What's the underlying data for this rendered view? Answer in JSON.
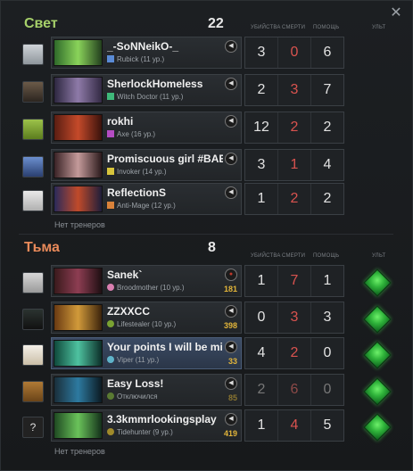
{
  "radiant": {
    "title": "Свет",
    "score": "22",
    "columns": {
      "kills": "Убийства",
      "deaths": "Смерти",
      "assists": "Помощь",
      "ult": "Ульт"
    },
    "players": [
      {
        "name": "_-SoNNeikO-_",
        "hero": "Rubick",
        "level_text": "(11 ур.)",
        "hero_color": "#5a8bd6",
        "kills": "3",
        "deaths": "0",
        "assists": "6"
      },
      {
        "name": "SherlockHomeless",
        "hero": "Witch Doctor",
        "level_text": "(11 ур.)",
        "hero_color": "#3fb97a",
        "kills": "2",
        "deaths": "3",
        "assists": "7"
      },
      {
        "name": "rokhi",
        "hero": "Axe",
        "level_text": "(16 ур.)",
        "hero_color": "#b44cc3",
        "kills": "12",
        "deaths": "2",
        "assists": "2"
      },
      {
        "name": "Promiscuous girl #BAE",
        "hero": "Invoker",
        "level_text": "(14 ур.)",
        "hero_color": "#d7c43c",
        "kills": "3",
        "deaths": "1",
        "assists": "4"
      },
      {
        "name": "ReflectionS",
        "hero": "Anti-Mage",
        "level_text": "(12 ур.)",
        "hero_color": "#d9823a",
        "kills": "1",
        "deaths": "2",
        "assists": "2"
      }
    ],
    "no_coaches": "Нет тренеров"
  },
  "dire": {
    "title": "Тьма",
    "score": "8",
    "columns": {
      "kills": "Убийства",
      "deaths": "Смерти",
      "assists": "Помощь",
      "ult": "Ульт"
    },
    "players": [
      {
        "name": "Sanek`",
        "hero": "Broodmother",
        "level_text": "(10 ур.)",
        "hero_color": "#d97fb0",
        "gold": "181",
        "kills": "1",
        "deaths": "7",
        "assists": "1"
      },
      {
        "name": "ZZXXCC",
        "hero": "Lifestealer",
        "level_text": "(10 ур.)",
        "hero_color": "#7aa232",
        "gold": "398",
        "kills": "0",
        "deaths": "3",
        "assists": "3"
      },
      {
        "name": "Your points I will be mine",
        "hero": "Viper",
        "level_text": "(11 ур.)",
        "hero_color": "#5fb3c9",
        "gold": "33",
        "kills": "4",
        "deaths": "2",
        "assists": "0"
      },
      {
        "name": "Easy Loss!",
        "hero": "Отключился",
        "level_text": "",
        "hero_color": "#5a7a32",
        "gold": "85",
        "kills": "2",
        "deaths": "6",
        "assists": "0"
      },
      {
        "name": "3.3kmmrlookingsplay",
        "hero": "Tidehunter",
        "level_text": "(9 ур.)",
        "hero_color": "#a08a2a",
        "gold": "419",
        "kills": "1",
        "deaths": "4",
        "assists": "5"
      }
    ],
    "no_coaches": "Нет тренеров"
  },
  "colors": {
    "radiant_title": "#a6d06a",
    "dire_title": "#e98a5a",
    "ult_ready": "#3ccf4a",
    "gold": "#e2b53a",
    "deaths": "#d9534f"
  },
  "icons": {
    "close": "close-icon",
    "voice": "speaker-icon",
    "ult": "ultimate-ready-icon"
  }
}
